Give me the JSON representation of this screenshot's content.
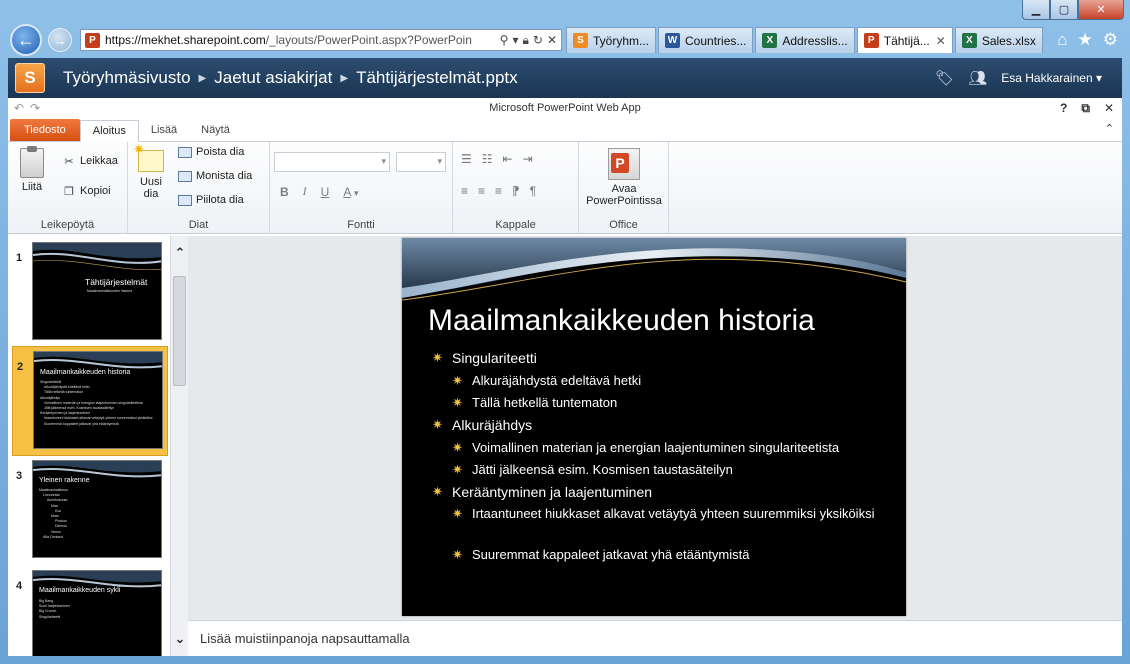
{
  "browser": {
    "url_host": "https://mekhet.sharepoint.com",
    "url_rest": "/_layouts/PowerPoint.aspx?PowerPoin",
    "tabs": [
      {
        "label": "Työryhm...",
        "icon": "sharepoint",
        "active": false
      },
      {
        "label": "Countries...",
        "icon": "word",
        "active": false
      },
      {
        "label": "Addresslis...",
        "icon": "excel",
        "active": false
      },
      {
        "label": "Tähtijä...",
        "icon": "powerpoint",
        "active": true
      },
      {
        "label": "Sales.xlsx",
        "icon": "excel",
        "active": false
      }
    ],
    "tab_close": "✕"
  },
  "sharepoint": {
    "breadcrumb": [
      "Työryhmäsivusto",
      "Jaetut asiakirjat",
      "Tähtijärjestelmät.pptx"
    ],
    "user": "Esa Hakkarainen"
  },
  "app": {
    "title": "Microsoft PowerPoint Web App",
    "help": "?"
  },
  "ribbon": {
    "tabs": {
      "file": "Tiedosto",
      "home": "Aloitus",
      "insert": "Lisää",
      "view": "Näytä"
    },
    "clipboard": {
      "paste": "Liitä",
      "cut": "Leikkaa",
      "copy": "Kopioi",
      "label": "Leikepöytä"
    },
    "slides": {
      "new_line1": "Uusi",
      "new_line2": "dia",
      "delete": "Poista dia",
      "duplicate": "Monista dia",
      "hide": "Piilota dia",
      "label": "Diat"
    },
    "font": {
      "label": "Fontti",
      "bold": "B",
      "italic": "I",
      "underline": "U",
      "color": "A"
    },
    "paragraph": {
      "label": "Kappale"
    },
    "office": {
      "open_line1": "Avaa",
      "open_line2": "PowerPointissa",
      "label": "Office"
    }
  },
  "thumbnails": [
    {
      "number": "1",
      "title": "Tähtijärjestelmät",
      "subtitle": "Maailmankaikkeuden historia",
      "lines": []
    },
    {
      "number": "2",
      "title": "Maailmankaikkeuden historia",
      "subtitle": "",
      "lines": [
        "Singulariteetti",
        "Alkuräjähdystä edeltävä hetki",
        "Tällä hetkellä tuntematon",
        "Alkuräjähdys",
        "Voimallinen materian ja energian laajentuminen singulariteetista",
        "Jätti jälkeensä esim. Kosmisen taustasäteilyn",
        "Kerääntyminen ja laajentuminen",
        "Irtaantuneet hiukkaset alkavat vetäytyä yhteen suuremmiksi yksiköiksi",
        "Suuremmat kappaleet jatkavat yhä etääntymistä"
      ]
    },
    {
      "number": "3",
      "title": "Yleinen rakenne",
      "subtitle": "",
      "lines": [
        "Maailmankaikkeus",
        "Linnunrata",
        "Aurinkokunta",
        "Maa",
        "Kuu",
        "Mars",
        "Phobos",
        "Deimos",
        "Venus",
        "Alfa Centauri"
      ]
    },
    {
      "number": "4",
      "title": "Maailmankaikkeuden sykli",
      "subtitle": "",
      "lines": [
        "Big Bang",
        "Suuri laajentuminen",
        "Big Crunch",
        "Singulariteetti"
      ]
    }
  ],
  "slide": {
    "title": "Maailmankaikkeuden historia",
    "bullets": [
      {
        "level": 1,
        "text": "Singulariteetti"
      },
      {
        "level": 2,
        "text": "Alkuräjähdystä edeltävä hetki"
      },
      {
        "level": 2,
        "text": "Tällä hetkellä tuntematon"
      },
      {
        "level": 1,
        "text": "Alkuräjähdys"
      },
      {
        "level": 2,
        "text": "Voimallinen materian ja energian laajentuminen singulariteetista"
      },
      {
        "level": 2,
        "text": "Jätti jälkeensä esim. Kosmisen taustasäteilyn"
      },
      {
        "level": 1,
        "text": "Kerääntyminen ja laajentuminen"
      },
      {
        "level": 2,
        "text": "Irtaantuneet hiukkaset alkavat vetäytyä yhteen suuremmiksi yksiköiksi",
        "wrap": true
      },
      {
        "level": 2,
        "text": "Suuremmat kappaleet jatkavat yhä etääntymistä"
      }
    ]
  },
  "notes": {
    "placeholder": "Lisää muistiinpanoja napsauttamalla"
  },
  "colors": {
    "sharepoint_bar": "#1e3a5a",
    "file_tab": "#e2631f",
    "selected_thumb": "#f5c043",
    "bullet": "#f2c13a"
  }
}
